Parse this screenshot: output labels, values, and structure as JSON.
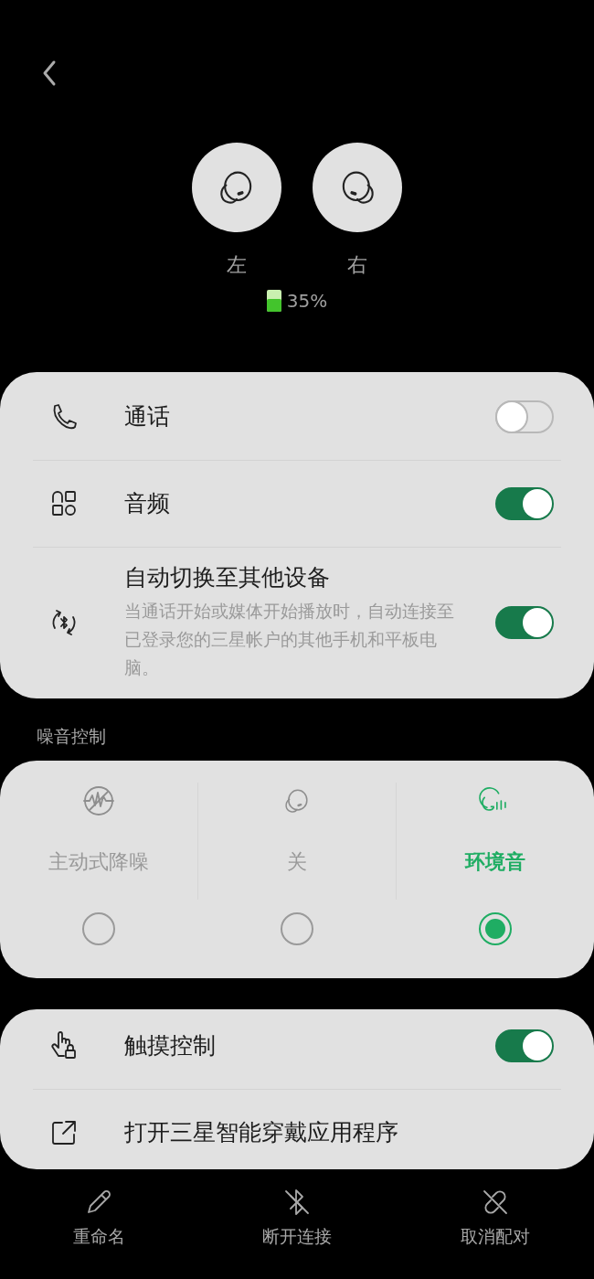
{
  "earbuds": [
    {
      "label": "左"
    },
    {
      "label": "右"
    }
  ],
  "battery": {
    "reading": "35%"
  },
  "settings": [
    {
      "kind": "toggle",
      "label": "通话",
      "on": false
    },
    {
      "kind": "toggle",
      "label": "音频",
      "on": true
    },
    {
      "kind": "toggle",
      "label": "自动切换至其他设备",
      "description": "当通话开始或媒体开始播放时，自动连接至已登录您的三星帐户的其他手机和平板电脑。",
      "on": true
    }
  ],
  "noise_control": {
    "title": "噪音控制",
    "modes": [
      {
        "label": "主动式降噪",
        "selected": false
      },
      {
        "label": "关",
        "selected": false
      },
      {
        "label": "环境音",
        "selected": true
      }
    ]
  },
  "more_settings": [
    {
      "kind": "toggle",
      "label": "触摸控制",
      "on": true
    },
    {
      "kind": "link",
      "label": "打开三星智能穿戴应用程序"
    }
  ],
  "actions": [
    {
      "label": "重命名"
    },
    {
      "label": "断开连接"
    },
    {
      "label": "取消配对"
    }
  ]
}
